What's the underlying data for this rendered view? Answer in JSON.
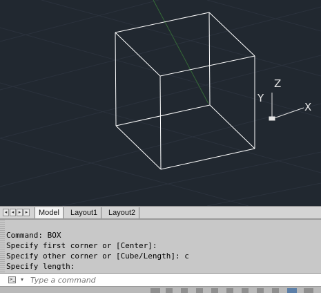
{
  "viewport": {
    "ucs": {
      "x_label": "X",
      "y_label": "Y",
      "z_label": "Z"
    },
    "colors": {
      "background": "#212830",
      "wireframe": "#ffffff",
      "grid": "#2c3440",
      "y_axis": "#3a7a3a"
    }
  },
  "layout_tabs": {
    "nav_icons": [
      "first-tab-icon",
      "prev-tab-icon",
      "next-tab-icon",
      "last-tab-icon"
    ],
    "tabs": [
      {
        "label": "Model",
        "active": true
      },
      {
        "label": "Layout1",
        "active": false
      },
      {
        "label": "Layout2",
        "active": false
      }
    ]
  },
  "command_window": {
    "history": [
      "Command: BOX",
      "Specify first corner or [Center]:",
      "Specify other corner or [Cube/Length]: c",
      "Specify length:"
    ],
    "prompt_icon": "command-prompt-icon",
    "input": {
      "value": "",
      "placeholder": "Type a command"
    }
  }
}
